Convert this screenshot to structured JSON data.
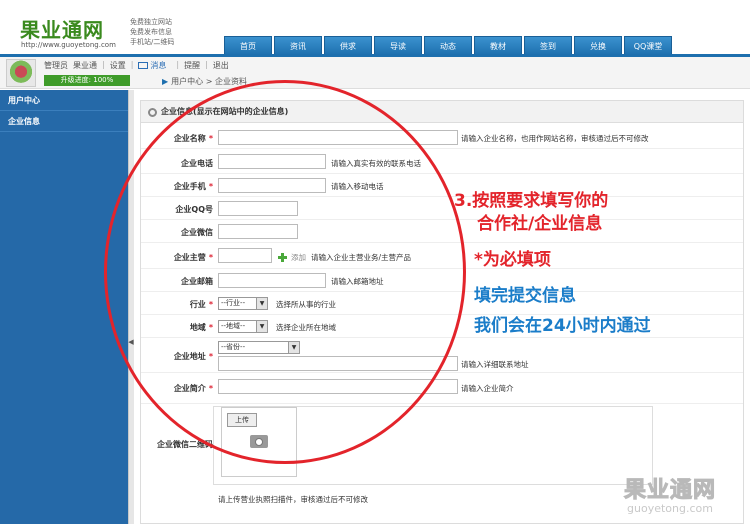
{
  "header": {
    "logo_title": "果业通网",
    "logo_url": "http://www.guoyetong.com",
    "taglines": [
      "免费独立网站",
      "免费发布信息",
      "手机站/二维码"
    ]
  },
  "nav": [
    "首页",
    "资讯",
    "供求",
    "导读",
    "动态",
    "教材",
    "签到",
    "兑换",
    "QQ课堂"
  ],
  "userbar": {
    "role": "管理员",
    "username": "果业通",
    "settings": "设置",
    "messages": "消息",
    "remind": "提醒",
    "logout": "退出",
    "progress_label": "升级进度: 100%",
    "progress_value": 100,
    "breadcrumb": "用户中心 > 企业资料"
  },
  "sidebar": [
    "用户中心",
    "企业信息"
  ],
  "form": {
    "section_title": "企业信息(显示在网站中的企业信息)",
    "company_name": {
      "label": "企业名称",
      "hint": "请输入企业名称，也用作网站名称，审核通过后不可修改"
    },
    "phone": {
      "label": "企业电话",
      "hint": "请输入真实有效的联系电话"
    },
    "mobile": {
      "label": "企业手机",
      "hint": "请输入移动电话"
    },
    "qq": {
      "label": "企业QQ号"
    },
    "wechat": {
      "label": "企业微信"
    },
    "business": {
      "label": "企业主营",
      "add": "添加",
      "hint": "请输入企业主营业务/主营产品"
    },
    "email": {
      "label": "企业邮箱",
      "hint": "请输入邮箱地址"
    },
    "industry": {
      "label": "行业",
      "select": "--行业--",
      "hint": "选择所从事的行业"
    },
    "region": {
      "label": "地域",
      "select": "--地域--",
      "hint": "选择企业所在地域"
    },
    "address": {
      "label": "企业地址",
      "select": "--省份--",
      "hint": "请输入详细联系地址"
    },
    "intro": {
      "label": "企业简介",
      "hint": "请输入企业简介"
    },
    "qrcode": {
      "label": "企业微信二维码",
      "upload": "上传"
    },
    "license_hint": "请上传营业执照扫描件，审核通过后不可修改"
  },
  "annotations": {
    "line1": "3.按照要求填写你的",
    "line2": "合作社/企业信息",
    "line3": "*为必填项",
    "line4": "填完提交信息",
    "line5": "我们会在24小时内通过"
  },
  "watermark": {
    "title": "果业通网",
    "url": "guoyetong.com"
  },
  "colors": {
    "nav": "#1d6fae",
    "sidebar": "#2569a8",
    "annotation_red": "#e3242b",
    "annotation_blue": "#1b7dc9",
    "progress": "#3f9c2a"
  }
}
